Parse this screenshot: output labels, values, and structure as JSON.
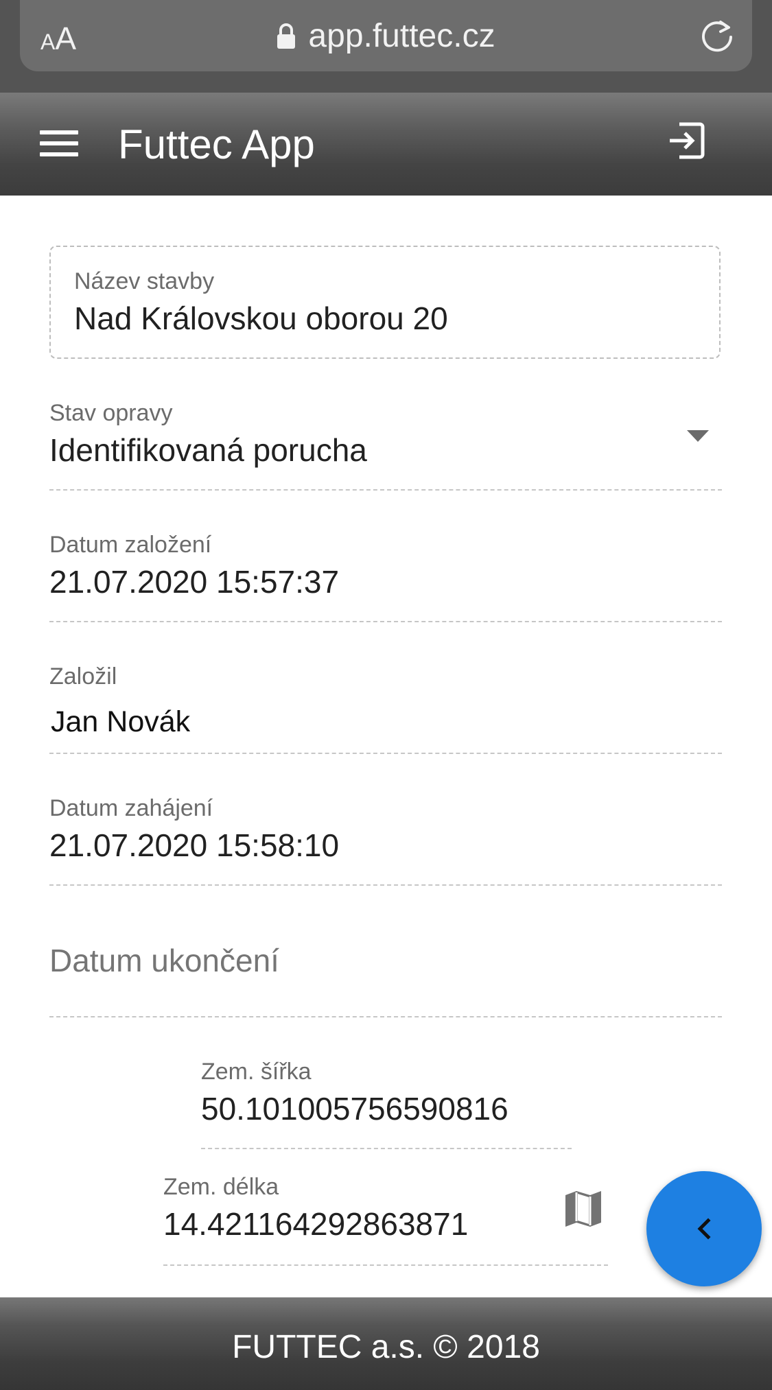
{
  "browser": {
    "text_size_small": "A",
    "text_size_large": "A",
    "url": "app.futtec.cz"
  },
  "appbar": {
    "title": "Futtec App"
  },
  "form": {
    "building_name": {
      "label": "Název stavby",
      "value": "Nad Královskou oborou 20"
    },
    "repair_state": {
      "label": "Stav opravy",
      "value": "Identifikovaná porucha"
    },
    "created_date": {
      "label": "Datum založení",
      "value": "21.07.2020 15:57:37"
    },
    "created_by": {
      "label": "Založil",
      "value": "Jan Novák"
    },
    "start_date": {
      "label": "Datum zahájení",
      "value": "21.07.2020 15:58:10"
    },
    "end_date": {
      "placeholder": "Datum ukončení"
    },
    "latitude": {
      "label": "Zem. šířka",
      "value": "50.101005756590816"
    },
    "longitude": {
      "label": "Zem. délka",
      "value": "14.421164292863871"
    }
  },
  "footer": {
    "text": "FUTTEC a.s. © 2018"
  },
  "icons": {
    "lock": "lock-icon",
    "reload": "reload-icon",
    "menu": "menu-icon",
    "logout": "logout-icon",
    "dropdown": "dropdown-arrow-icon",
    "map": "map-icon",
    "back": "chevron-left-icon"
  },
  "colors": {
    "fab": "#1e80e2",
    "appbar": "#444444",
    "browser_bar": "#545454"
  }
}
